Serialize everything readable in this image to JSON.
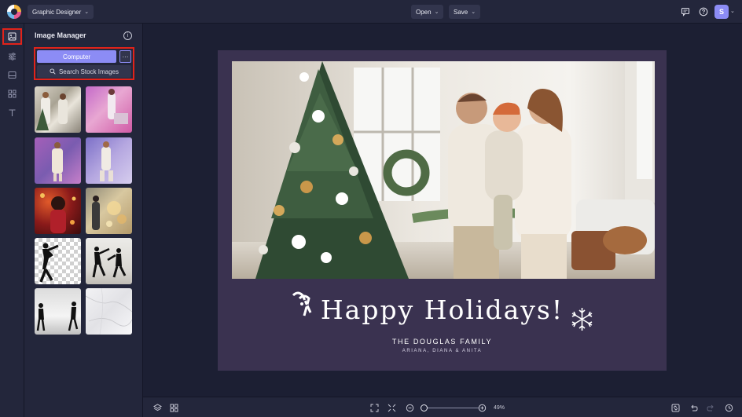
{
  "header": {
    "workspace_label": "Graphic Designer",
    "open_label": "Open",
    "save_label": "Save",
    "user_initial": "S"
  },
  "rail": {
    "items": [
      {
        "name": "image-manager",
        "icon": "image-icon",
        "active": true
      },
      {
        "name": "adjustments",
        "icon": "sliders-icon",
        "active": false
      },
      {
        "name": "layouts",
        "icon": "layout-icon",
        "active": false
      },
      {
        "name": "graphics",
        "icon": "grid-icon",
        "active": false
      },
      {
        "name": "text",
        "icon": "text-icon",
        "active": false
      }
    ]
  },
  "panel": {
    "title": "Image Manager",
    "computer_label": "Computer",
    "more_label": "···",
    "stock_label": "Search Stock Images",
    "thumbnail_count": 10
  },
  "card": {
    "greeting": "Happy Holidays!",
    "family": "THE DOUGLAS FAMILY",
    "names": "ARIANA, DIANA & ANITA",
    "background": "#3a3250"
  },
  "footer": {
    "zoom": "49%"
  },
  "colors": {
    "accent": "#8c8cf5",
    "highlight": "#e2231a",
    "chrome": "#23263b",
    "workspace": "#1c1f33"
  }
}
